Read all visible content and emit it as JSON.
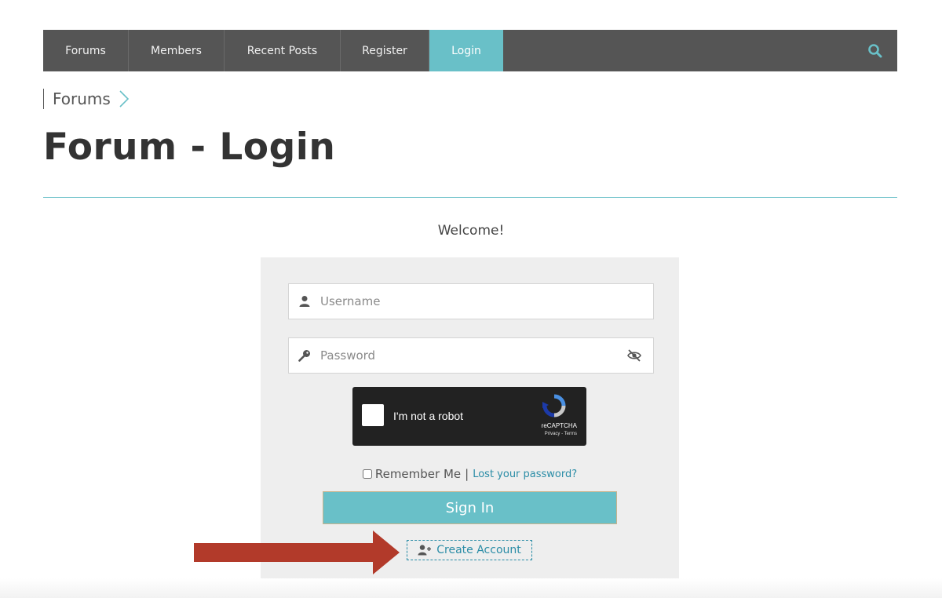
{
  "nav": {
    "items": [
      {
        "label": "Forums"
      },
      {
        "label": "Members"
      },
      {
        "label": "Recent Posts"
      },
      {
        "label": "Register"
      },
      {
        "label": "Login",
        "active": true
      }
    ],
    "search_icon": "search-icon"
  },
  "breadcrumb": {
    "label": "Forums",
    "icon": "chevron-right-icon"
  },
  "page": {
    "title": "Forum - Login"
  },
  "login": {
    "welcome": "Welcome!",
    "username_placeholder": "Username",
    "password_placeholder": "Password",
    "captcha_label": "I'm not a robot",
    "captcha_brand": "reCAPTCHA",
    "captcha_terms": "Privacy - Terms",
    "remember_label": "Remember Me",
    "separator": "|",
    "lost_password": "Lost your password?",
    "signin_label": "Sign In",
    "create_account_label": "Create Account"
  },
  "colors": {
    "accent": "#69c0c8",
    "nav_bg": "#555555",
    "link": "#2a8ca6",
    "arrow": "#b23a2a"
  }
}
